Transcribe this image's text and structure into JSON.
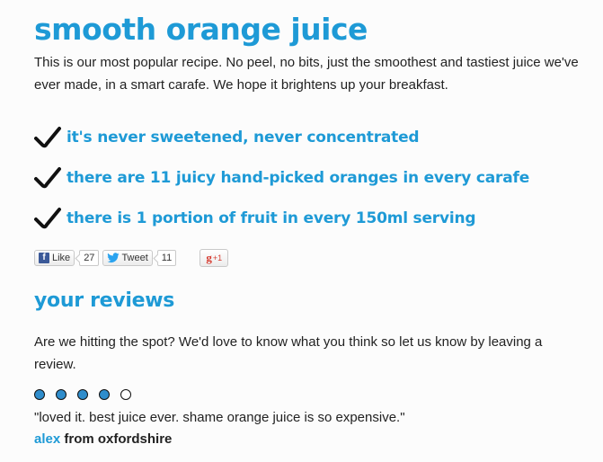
{
  "product": {
    "title": "smooth orange juice",
    "intro": "This is our most popular recipe. No peel, no bits, just the smoothest and tastiest juice we've ever made, in a smart carafe. We hope it brightens up your breakfast."
  },
  "features": [
    {
      "icon": "checkmark-icon",
      "text": "it's never sweetened, never concentrated"
    },
    {
      "icon": "checkmark-icon",
      "text": "there are 11 juicy hand-picked oranges in every carafe"
    },
    {
      "icon": "checkmark-icon",
      "text": "there is 1 portion of fruit in every 150ml serving"
    }
  ],
  "social": {
    "like_label": "Like",
    "like_count": "27",
    "tweet_label": "Tweet",
    "tweet_count": "11",
    "gplus_g": "g",
    "gplus_label": "+1"
  },
  "reviews": {
    "title": "your reviews",
    "intro": "Are we hitting the spot? We'd love to know what you think so let us know by leaving a review.",
    "items": [
      {
        "rating": 4,
        "rating_max": 5,
        "quote": "\"loved it. best juice ever. shame orange juice is so expensive.\"",
        "author_name": "alex",
        "author_location": " from oxfordshire"
      }
    ]
  },
  "colors": {
    "accent": "#1e9ad6",
    "rating_fill": "#2f8dcc",
    "text": "#222222"
  }
}
